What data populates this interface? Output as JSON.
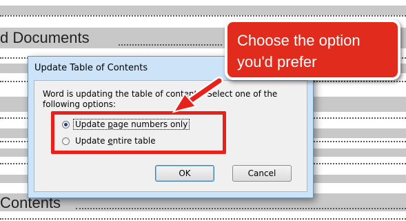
{
  "document": {
    "heading_top": "d Documents",
    "heading_bottom": "Contents"
  },
  "dialog": {
    "title": "Update Table of Contents",
    "message": "Word is updating the table of contents.  Select one of the following options:",
    "options": [
      {
        "label_pre": "Update ",
        "label_access": "p",
        "label_post": "age numbers only",
        "checked": true
      },
      {
        "label_pre": "Update ",
        "label_access": "e",
        "label_post": "ntire table",
        "checked": false
      }
    ],
    "ok_label": "OK",
    "cancel_label": "Cancel"
  },
  "annotation": {
    "callout_text": "Choose the option you'd prefer",
    "color": "#e02b1d"
  }
}
